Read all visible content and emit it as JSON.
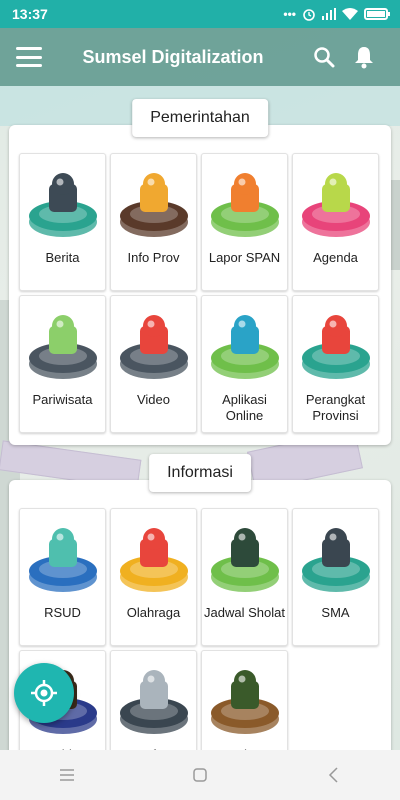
{
  "status": {
    "time": "13:37",
    "dots": "•••",
    "battery_level": 0.9
  },
  "appbar": {
    "title": "Sumsel Digitalization"
  },
  "sections": [
    {
      "title": "Pemerintahan",
      "items": [
        {
          "label": "Berita",
          "icon": "laptop-code-icon",
          "base": "#2aa38f",
          "accent": "#3d4a55"
        },
        {
          "label": "Info Prov",
          "icon": "pen-icon",
          "base": "#5a3a2a",
          "accent": "#f0a830"
        },
        {
          "label": "Lapor SPAN",
          "icon": "megaphone-icon",
          "base": "#6fbf4a",
          "accent": "#f07f2f"
        },
        {
          "label": "Agenda",
          "icon": "calendar-icon",
          "base": "#e8447a",
          "accent": "#b8d84a"
        },
        {
          "label": "Pariwisata",
          "icon": "map-pin-heart-icon",
          "base": "#4a5560",
          "accent": "#8ccf6a"
        },
        {
          "label": "Video",
          "icon": "play-icon",
          "base": "#4a5560",
          "accent": "#e8453c"
        },
        {
          "label": "Aplikasi Online",
          "icon": "at-sign-icon",
          "base": "#6fbf4a",
          "accent": "#2aa3c7"
        },
        {
          "label": "Perangkat Provinsi",
          "icon": "map-location-icon",
          "base": "#2aa38f",
          "accent": "#e8453c"
        }
      ]
    },
    {
      "title": "Informasi",
      "items": [
        {
          "label": "RSUD",
          "icon": "hospital-icon",
          "base": "#2a6fbf",
          "accent": "#4fbfae"
        },
        {
          "label": "Olahraga",
          "icon": "basketball-icon",
          "base": "#f0b020",
          "accent": "#e8453c"
        },
        {
          "label": "Jadwal Sholat",
          "icon": "mosque-icon",
          "base": "#6fbf4a",
          "accent": "#2d4a3a"
        },
        {
          "label": "SMA",
          "icon": "graduation-cap-icon",
          "base": "#2aa38f",
          "accent": "#3a4650"
        },
        {
          "label": "Polda",
          "icon": "police-icon",
          "base": "#2a3a8a",
          "accent": "#3a2a1a"
        },
        {
          "label": "Daftar",
          "icon": "buildings-icon",
          "base": "#3a4650",
          "accent": "#aab4bc"
        },
        {
          "label": "Kodam",
          "icon": "soldier-icon",
          "base": "#8a5a2a",
          "accent": "#3a5a2a"
        }
      ]
    }
  ],
  "colors": {
    "primary": "#21b0a8",
    "appbar": "#5a968c"
  }
}
